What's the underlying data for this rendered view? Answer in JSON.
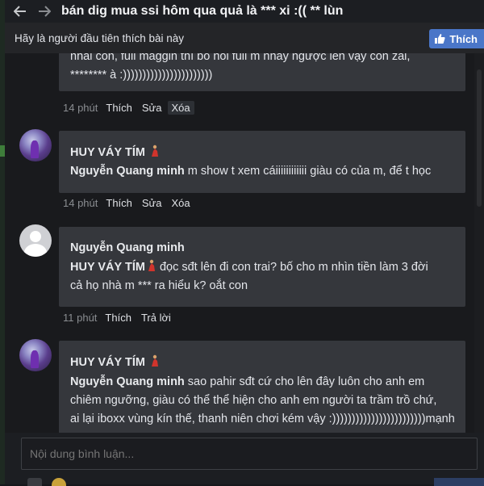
{
  "title": "bán dig mua ssi hôm qua quả là *** xi :(( ** lùn",
  "like_bar": {
    "prompt": "Hãy là người đầu tiên thích bài này",
    "button_label": "Thích"
  },
  "comments": [
    {
      "text_line1": "nhai con, full maggin thì bố nói full m nhảy ngược lên vậy con zai,",
      "text_line2": "******** à :)))))))))))))))))))))))",
      "time": "14 phút",
      "actions": [
        "Thích",
        "Sửa",
        "Xóa"
      ]
    },
    {
      "author": "HUY VÁY TÍM",
      "mention": "Nguyễn Quang minh",
      "text": " m show t xem cáiiiiiiiiiiii giàu có của m, để t học",
      "time": "14 phút",
      "actions": [
        "Thích",
        "Sửa",
        "Xóa"
      ]
    },
    {
      "author": "Nguyễn Quang minh",
      "mention": "HUY VÁY TÍM",
      "text_line1": " đọc sđt lên đi con trai? bố cho m nhìn tiền làm 3 đời",
      "text_line2": "cả họ nhà m *** ra hiểu k? oắt con",
      "time": "11 phút",
      "actions": [
        "Thích",
        "Trả lời"
      ]
    },
    {
      "author": "HUY VÁY TÍM",
      "mention": "Nguyễn Quang minh",
      "text_line1": " sao pahir sđt cứ cho lên đây luôn cho anh em",
      "text_line2": "chiêm ngưỡng, giàu có thể thể hiện cho anh em người ta trầm trồ chứ,",
      "text_line3": "ai lại iboxx vùng kín thế, thanh niên chơi kém vậy :))))))))))))))))))))))))mạnh"
    }
  ],
  "composer": {
    "placeholder": "Nội dung bình luận..."
  },
  "colors": {
    "background": "#191a1d",
    "bubble": "#35373c",
    "like_button": "#4a76c8"
  }
}
